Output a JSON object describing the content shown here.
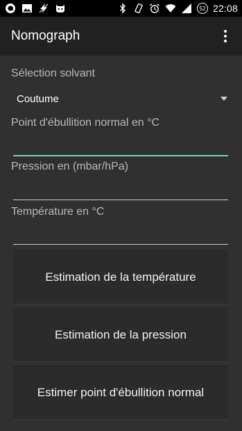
{
  "status_bar": {
    "time": "22:08",
    "battery_level": "52",
    "left_icons": [
      "app-notification-icon",
      "image-icon",
      "flash-icon",
      "cat-icon"
    ],
    "right_icons": [
      "bluetooth-icon",
      "vibrate-icon",
      "alarm-icon",
      "wifi-icon",
      "signal-icon",
      "battery-icon"
    ]
  },
  "app_bar": {
    "title": "Nomograph",
    "overflow_icon": "more-vert-icon"
  },
  "form": {
    "solvent_label": "Sélection solvant",
    "solvent_selected": "Coutume",
    "boiling_point_label": "Point d'ébullition normal en °C",
    "boiling_point_value": "",
    "pressure_label": "Pression en (mbar/hPa)",
    "pressure_value": "",
    "temperature_label": "Température en °C",
    "temperature_value": ""
  },
  "buttons": {
    "estimate_temperature": "Estimation de la température",
    "estimate_pressure": "Estimation de la pression",
    "estimate_boiling_point": "Estimer point d'ébullition normal"
  },
  "colors": {
    "background": "#303030",
    "app_bar": "#212121",
    "accent": "#80cbc4"
  }
}
